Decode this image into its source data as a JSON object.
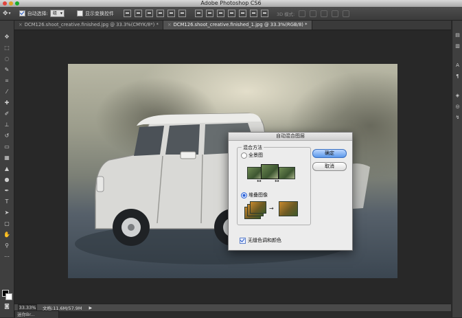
{
  "window": {
    "title": "Adobe Photoshop CS6"
  },
  "options_bar": {
    "auto_select_label": "自动选择:",
    "auto_select_value": "组",
    "show_transform_label": "显示变换控件",
    "mode_3d_label": "3D 模式:"
  },
  "tabs": [
    {
      "label": "DCM126.shoot_creative.finished.jpg @ 33.3%(CMYK/8*) *",
      "active": false
    },
    {
      "label": "DCM126.shoot_creative.finished_1.jpg @ 33.3%(RGB/8) *",
      "active": true
    }
  ],
  "dialog": {
    "title": "自动混合图层",
    "group_label": "混合方法",
    "option_panorama": "全景图",
    "option_stack": "堆叠图像",
    "selected_option": "stack",
    "ok_label": "确定",
    "cancel_label": "取消",
    "seamless_label": "无缝色调和颜色",
    "seamless_checked": true
  },
  "status": {
    "zoom": "33.33%",
    "doc_info": "文档:11.6M/57.9M",
    "arrow": "▶"
  },
  "mini_bridge": {
    "label": "迷你Br..."
  },
  "colors": {
    "accent": "#5b98ea",
    "traffic_close": "#e0443e",
    "traffic_min": "#dea123",
    "traffic_max": "#1aab29"
  }
}
